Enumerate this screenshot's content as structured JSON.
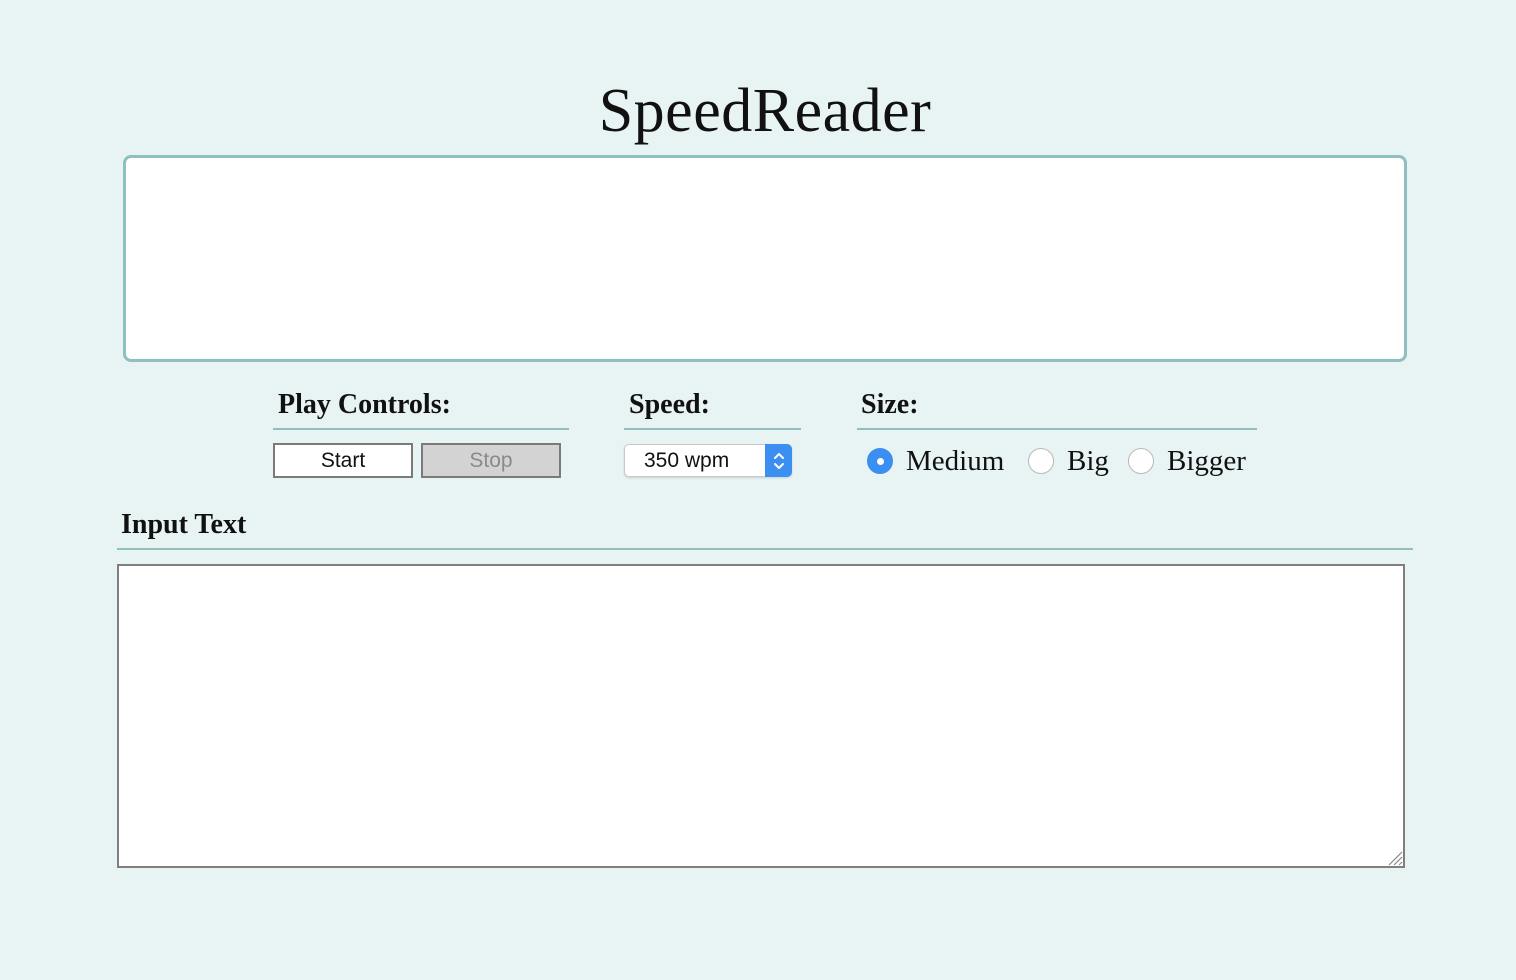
{
  "header": {
    "title": "SpeedReader"
  },
  "display": {
    "current_word": ""
  },
  "controls": {
    "play": {
      "heading": "Play Controls:",
      "start_label": "Start",
      "stop_label": "Stop",
      "stop_disabled": true
    },
    "speed": {
      "heading": "Speed:",
      "selected": "350 wpm",
      "stepper_icon": "up-down-chevron-icon"
    },
    "size": {
      "heading": "Size:",
      "options": [
        {
          "label": "Medium",
          "checked": true
        },
        {
          "label": "Big",
          "checked": false
        },
        {
          "label": "Bigger",
          "checked": false
        }
      ]
    }
  },
  "input": {
    "heading": "Input Text",
    "value": "",
    "placeholder": ""
  },
  "colors": {
    "background": "#e8f4f4",
    "accent_border": "#8fbfbf",
    "radio_selected": "#3b8ff0",
    "disabled_button": "#d3d3d3"
  }
}
